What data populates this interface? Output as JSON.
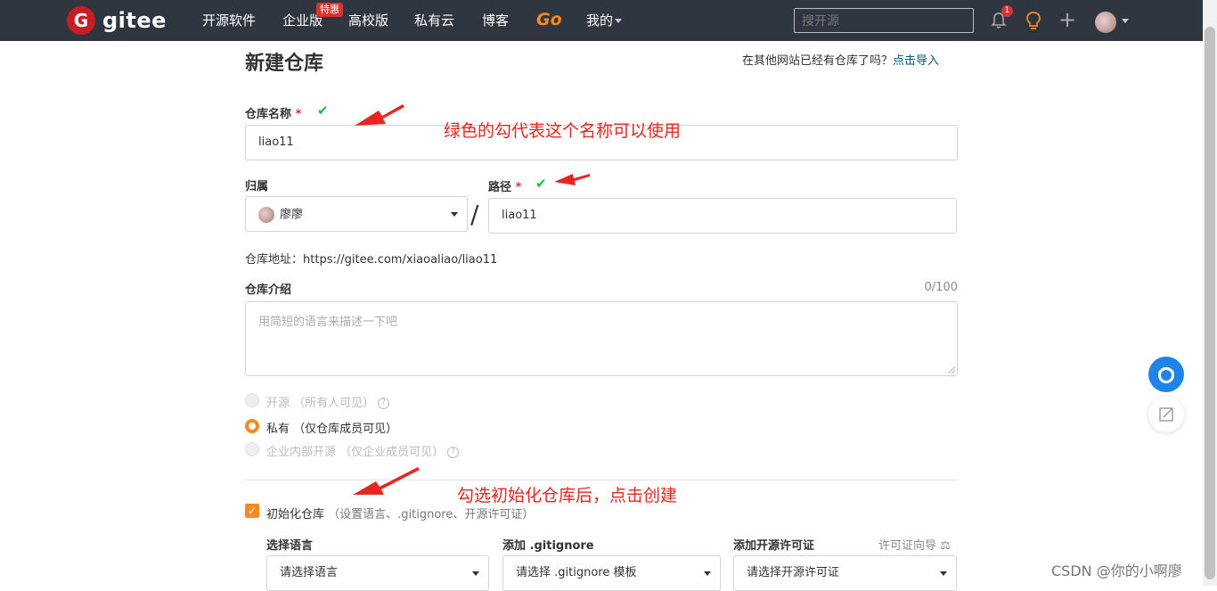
{
  "nav": {
    "logo_letter": "G",
    "logo_text": "gitee",
    "items": [
      "开源软件",
      "企业版",
      "高校版",
      "私有云",
      "博客"
    ],
    "enterprise_badge": "特惠",
    "go": "Go",
    "mine": "我的",
    "search_placeholder": "搜开源",
    "notification_count": "1"
  },
  "form": {
    "title": "新建仓库",
    "import_hint": "在其他网站已经有仓库了吗？",
    "import_link": "点击导入",
    "repo_name_label": "仓库名称",
    "required_mark": "*",
    "repo_name_value": "liao11",
    "owner_label": "归属",
    "owner_value": "廖廖",
    "path_label": "路径",
    "path_value": "liao11",
    "separator": "/",
    "address_label": "仓库地址：",
    "address_value": "https://gitee.com/xiaoaliao/liao11",
    "intro_label": "仓库介绍",
    "intro_counter": "0/100",
    "intro_placeholder": "用简短的语言来描述一下吧",
    "visibility": {
      "public": "开源 （所有人可见）",
      "private": "私有 （仅仓库成员可见）",
      "internal": "企业内部开源 （仅企业成员可见）",
      "selected": "private"
    },
    "init_label": "初始化仓库",
    "init_sub": "（设置语言、.gitignore、开源许可证）",
    "init_checked": true,
    "language_label": "选择语言",
    "language_value": "请选择语言",
    "gitignore_label": "添加 .gitignore",
    "gitignore_value": "请选择 .gitignore 模板",
    "license_label": "添加开源许可证",
    "license_guide": "许可证向导",
    "license_value": "请选择开源许可证"
  },
  "annotations": {
    "name_ok": "绿色的勾代表这个名称可以使用",
    "init_hint": "勾选初始化仓库后，点击创建"
  },
  "watermark": "CSDN @你的小啊廖",
  "colors": {
    "nav_bg": "#2f3640",
    "accent": "#f68a1e",
    "brand": "#c71d23",
    "ok": "#21ba45",
    "annotation": "#e6261f"
  }
}
